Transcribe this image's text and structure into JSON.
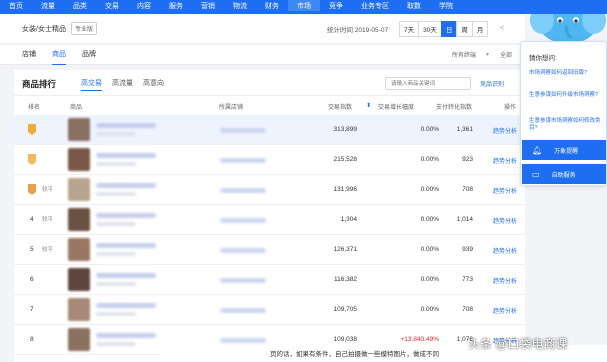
{
  "topnav": {
    "items": [
      "首页",
      "流量",
      "品类",
      "交易",
      "内容",
      "服务",
      "营销",
      "物流",
      "财务",
      "市场",
      "竞争",
      "业务专区",
      "取数",
      "学院"
    ],
    "active_index": 9
  },
  "subbar": {
    "breadcrumb": "女装/女士精品",
    "badge": "专业版",
    "stat_time": "统计时间 2019-05-07",
    "ranges": [
      "7天",
      "30天",
      "日",
      "周",
      "月"
    ],
    "active_range": 2,
    "prev": "<"
  },
  "tabs": {
    "items": [
      "店铺",
      "商品",
      "品牌"
    ],
    "active_index": 1,
    "channel": "所有终端",
    "device": "全部"
  },
  "card": {
    "title": "商品排行",
    "sub_tabs": [
      "高交易",
      "高流量",
      "高意向"
    ],
    "active_sub": 0,
    "search_placeholder": "请输入商品关键词",
    "export": "竞品识别"
  },
  "table": {
    "headers": {
      "rank": "排名",
      "product": "商品",
      "shop": "所属店铺",
      "trade_index": "交易指数",
      "growth": "交易增长幅度",
      "conversion": "支付转化指数",
      "op": "操作"
    },
    "trend_label": "趋势分析",
    "rows": [
      {
        "rank": "1",
        "label": "",
        "trade": "313,899",
        "growth": "0.00%",
        "conv": "1,361"
      },
      {
        "rank": "2",
        "label": "",
        "trade": "215,528",
        "growth": "0.00%",
        "conv": "923"
      },
      {
        "rank": "3",
        "label": "较平",
        "trade": "131,996",
        "growth": "0.00%",
        "conv": "708"
      },
      {
        "rank": "4",
        "label": "较平",
        "trade": "1,304",
        "growth": "0.00%",
        "conv": "1,014"
      },
      {
        "rank": "5",
        "label": "较平",
        "trade": "126,371",
        "growth": "0.00%",
        "conv": "939"
      },
      {
        "rank": "6",
        "label": "",
        "trade": "116,382",
        "growth": "0.00%",
        "conv": "773"
      },
      {
        "rank": "7",
        "label": "",
        "trade": "109,705",
        "growth": "0.00%",
        "conv": "708"
      },
      {
        "rank": "8",
        "label": "",
        "trade": "109,038",
        "growth": "+13,840.49%",
        "conv": "1,076"
      }
    ]
  },
  "side_panel": {
    "title": "猜你想问:",
    "questions": [
      "市场洞察如何返回旧版?",
      "生意参谋如何升级市场洞察?",
      "生意参谋市场洞察如何修改类目?"
    ],
    "btn_alert": "万象提醒",
    "btn_service": "自助服务"
  },
  "caption": "页的话，如果有条件，自己拍摄做一些模特图片，做成不同",
  "watermark": "头条 @口袋电商课",
  "colors": {
    "brand": "#1e6ef2",
    "negative": "#e0262b"
  }
}
